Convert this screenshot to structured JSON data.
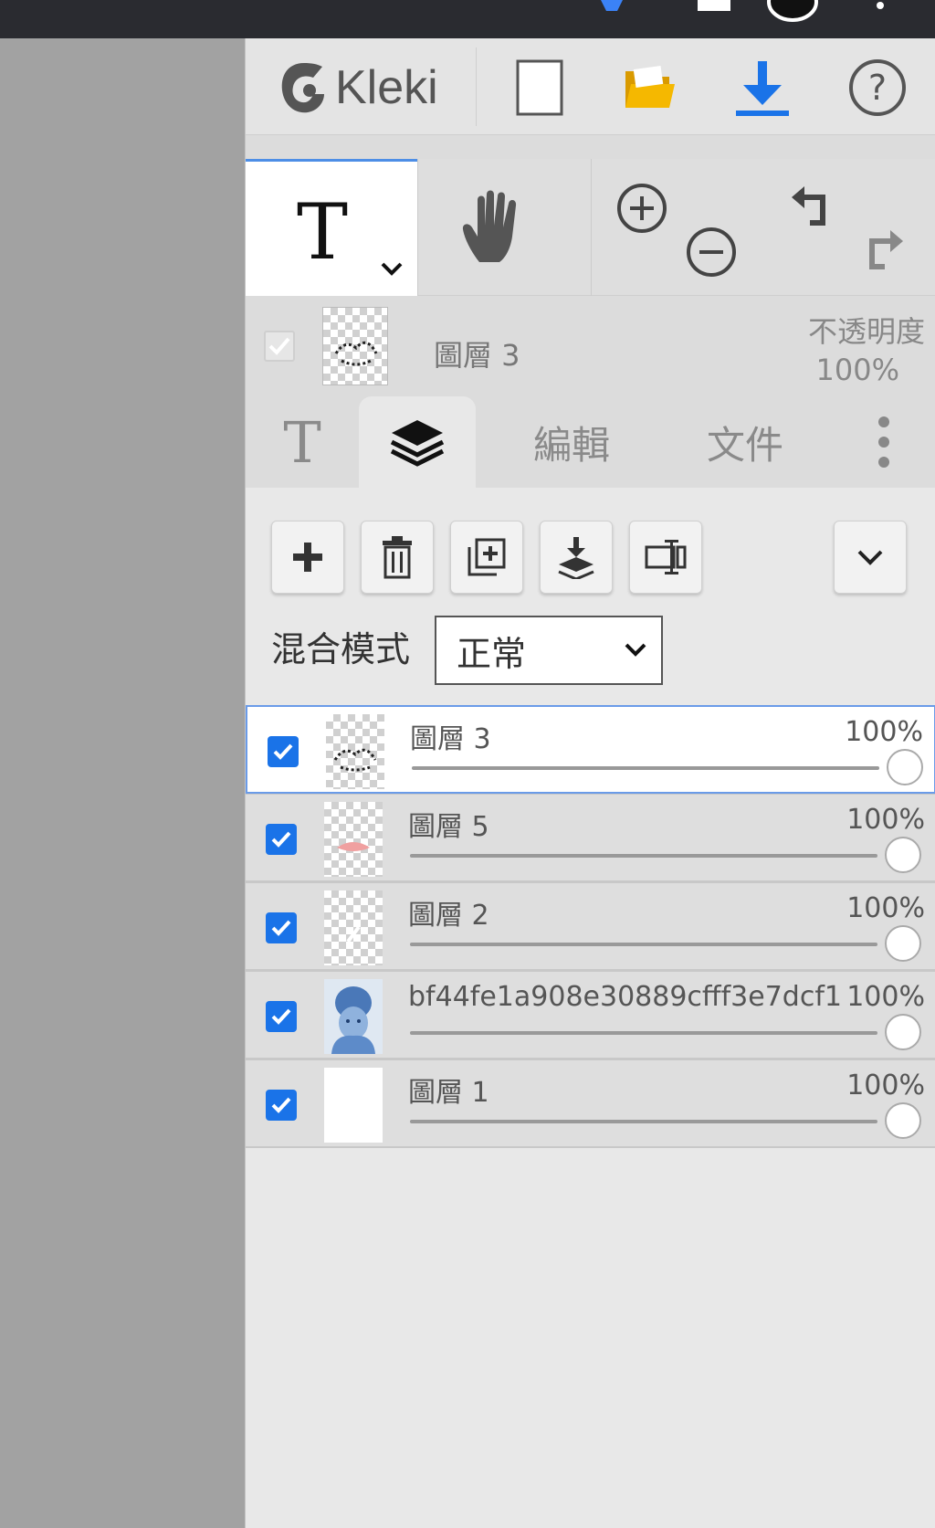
{
  "app": {
    "logo_text": "Kleki"
  },
  "colors": {
    "accent_blue": "#1a73e8",
    "folder_yellow": "#f5b800",
    "panel_bg": "#dcdcdc"
  },
  "toolbar": {
    "icons": [
      "new-image-icon",
      "open-folder-icon",
      "download-icon",
      "help-icon"
    ]
  },
  "tools": {
    "active_tool_glyph": "T",
    "items": [
      "text-tool-icon",
      "hand-tool-icon",
      "zoom-in-icon",
      "zoom-out-icon",
      "undo-icon",
      "redo-icon"
    ]
  },
  "current_layer": {
    "name": "圖層 3",
    "opacity_label": "不透明度",
    "opacity_value": "100%"
  },
  "tabs": {
    "text_glyph": "T",
    "edit": "編輯",
    "file": "文件"
  },
  "layer_actions": {
    "blend_label": "混合模式",
    "blend_value": "正常"
  },
  "layers": [
    {
      "name": "圖層 3",
      "opacity": "100%",
      "opacity_value": 100,
      "checked": true,
      "selected": true
    },
    {
      "name": "圖層 5",
      "opacity": "100%",
      "opacity_value": 100,
      "checked": true,
      "selected": false
    },
    {
      "name": "圖層 2",
      "opacity": "100%",
      "opacity_value": 100,
      "checked": true,
      "selected": false
    },
    {
      "name": "bf44fe1a908e30889cfff3e7dcf1",
      "opacity": "100%",
      "opacity_value": 100,
      "checked": true,
      "selected": false
    },
    {
      "name": "圖層 1",
      "opacity": "100%",
      "opacity_value": 100,
      "checked": true,
      "selected": false
    }
  ]
}
